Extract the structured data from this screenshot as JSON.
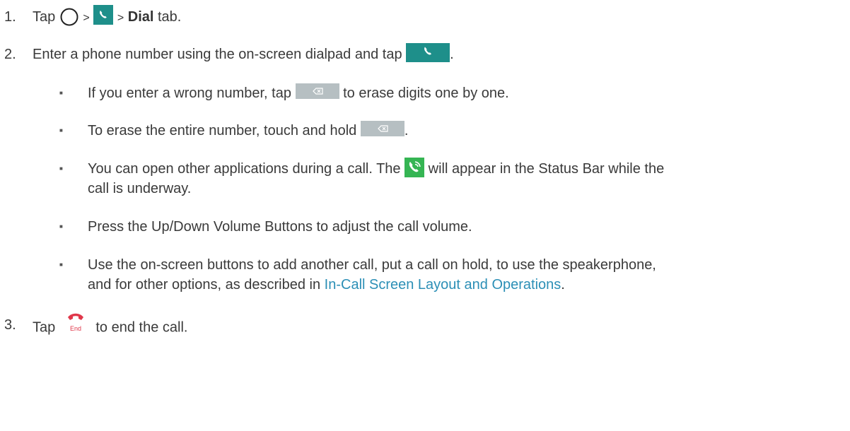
{
  "steps": [
    {
      "num": "1.",
      "tap": "Tap",
      "gt1": ">",
      "gt2": ">",
      "dial": "Dial",
      "tab": "tab."
    },
    {
      "num": "2.",
      "text": "Enter a phone number using the on-screen dialpad and tap",
      "end": "."
    },
    {
      "num": "3.",
      "tap": "Tap",
      "text": "to end the call."
    }
  ],
  "bullets": {
    "b1_pre": "If you enter a wrong number, tap",
    "b1_post": "to erase digits one by one.",
    "b2_pre": "To erase the entire number, touch and hold",
    "b2_post": ".",
    "b3_pre": "You can open other applications during a call. The",
    "b3_post": "will appear in the Status Bar while the",
    "b3_cont": "call is underway.",
    "b4": "Press the Up/Down Volume Buttons to adjust the call volume.",
    "b5_line1": "Use the on-screen buttons to add another call, put a call on hold, to use the speakerphone,",
    "b5_pre": "and for other options, as described in",
    "b5_link": "In-Call Screen Layout and Operations",
    "b5_post": "."
  },
  "icons": {
    "home": "home-circle-icon",
    "phone_app": "phone-app-icon",
    "call": "call-button-icon",
    "backspace": "backspace-icon",
    "status_call": "status-bar-call-icon",
    "end_call": "end-call-icon",
    "end_label": "End"
  },
  "colors": {
    "teal": "#1e8f8a",
    "backspace_gray": "#b6bfc2",
    "status_green": "#35b553",
    "end_red": "#e0374a",
    "link": "#2c8fb6"
  }
}
